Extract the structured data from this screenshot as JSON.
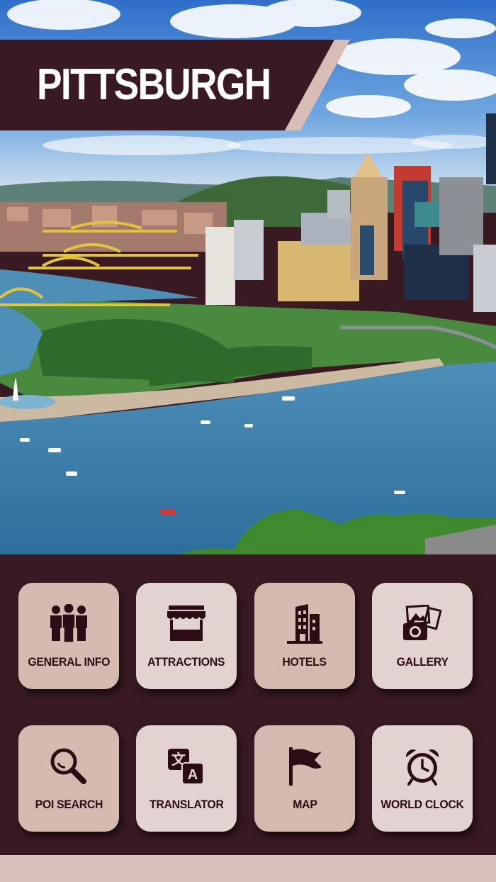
{
  "app": {
    "title": "PITTSBURGH"
  },
  "menu": {
    "items": [
      {
        "label": "GENERAL INFO",
        "icon": "people-group-icon"
      },
      {
        "label": "ATTRACTIONS",
        "icon": "storefront-icon"
      },
      {
        "label": "HOTELS",
        "icon": "hotel-building-icon"
      },
      {
        "label": "GALLERY",
        "icon": "gallery-photos-icon"
      },
      {
        "label": "POI SEARCH",
        "icon": "magnifier-icon"
      },
      {
        "label": "TRANSLATOR",
        "icon": "translate-icon"
      },
      {
        "label": "MAP",
        "icon": "flag-icon"
      },
      {
        "label": "WORLD CLOCK",
        "icon": "alarm-clock-icon"
      }
    ]
  },
  "colors": {
    "panel_background": "#3a1a22",
    "banner": "#3a1a22",
    "tile_dark": "#d6b9b0",
    "tile_light": "#e2d2d0",
    "icon_ink": "#2a0e14"
  }
}
